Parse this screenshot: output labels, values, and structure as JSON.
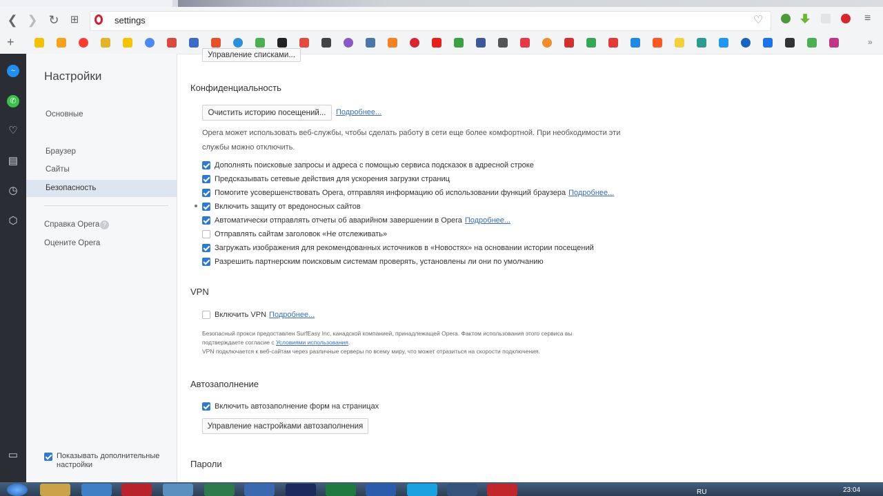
{
  "browser": {
    "address": "settings"
  },
  "nav": {
    "title": "Настройки",
    "items": [
      "Основные",
      "Браузер",
      "Сайты",
      "Безопасность"
    ],
    "active_index": 3,
    "help_label": "Справка Opera",
    "help_badge": "?",
    "rate_label": "Оцените Opera",
    "show_advanced_label_1": "Показывать дополнительные",
    "show_advanced_label_2": "настройки",
    "show_advanced_checked": true
  },
  "content": {
    "partial_button": "Управление списками...",
    "privacy": {
      "title": "Конфиденциальность",
      "clear_button": "Очистить историю посещений...",
      "more_link": "Подробнее...",
      "desc_1": "Opera может использовать веб-службы, чтобы сделать работу в сети еще более комфортной. При необходимости эти",
      "desc_2": "службы можно отключить.",
      "options": [
        {
          "label": "Дополнять поисковые запросы и адреса с помощью сервиса подсказок в адресной строке",
          "checked": true,
          "link": ""
        },
        {
          "label": "Предсказывать сетевые действия для ускорения загрузки страниц",
          "checked": true,
          "link": ""
        },
        {
          "label": "Помогите усовершенствовать Opera, отправляя информацию об использовании функций браузера",
          "checked": true,
          "link": "Подробнее..."
        },
        {
          "label": "Включить защиту от вредоносных сайтов",
          "checked": true,
          "link": ""
        },
        {
          "label": "Автоматически отправлять отчеты об аварийном завершении в Opera",
          "checked": true,
          "link": "Подробнее..."
        },
        {
          "label": "Отправлять сайтам заголовок «Не отслеживать»",
          "checked": false,
          "link": ""
        },
        {
          "label": "Загружать изображения для рекомендованных источников в «Новостях» на основании истории посещений",
          "checked": true,
          "link": ""
        },
        {
          "label": "Разрешить партнерским поисковым системам проверять, установлены ли они по умолчанию",
          "checked": true,
          "link": ""
        }
      ]
    },
    "vpn": {
      "title": "VPN",
      "enable_label": "Включить VPN",
      "enable_checked": false,
      "more_link": "Подробнее...",
      "fine_1": "Безопасный прокси предоставлен SurfEasy Inc, канадской компанией, принадлежащей Opera. Фактом использования этого сервиса вы",
      "fine_2a": "подтверждаете согласие с ",
      "fine_2_link": "Условиями использования",
      "fine_2b": ".",
      "fine_3": "VPN подключается к веб-сайтам через различные серверы по всему миру, что может отразиться на скорости подключения."
    },
    "autofill": {
      "title": "Автозаполнение",
      "enable_label": "Включить автозаполнение форм на страницах",
      "enable_checked": true,
      "manage_button": "Управление настройками автозаполнения"
    },
    "passwords": {
      "title": "Пароли"
    }
  },
  "taskbar": {
    "lang": "RU",
    "clock": "23:04"
  },
  "colors": {
    "accent": "#2e7ad0",
    "link": "#3a6cc7",
    "opera_red": "#d41e2a",
    "sidebar_dark": "#2a2d33"
  }
}
